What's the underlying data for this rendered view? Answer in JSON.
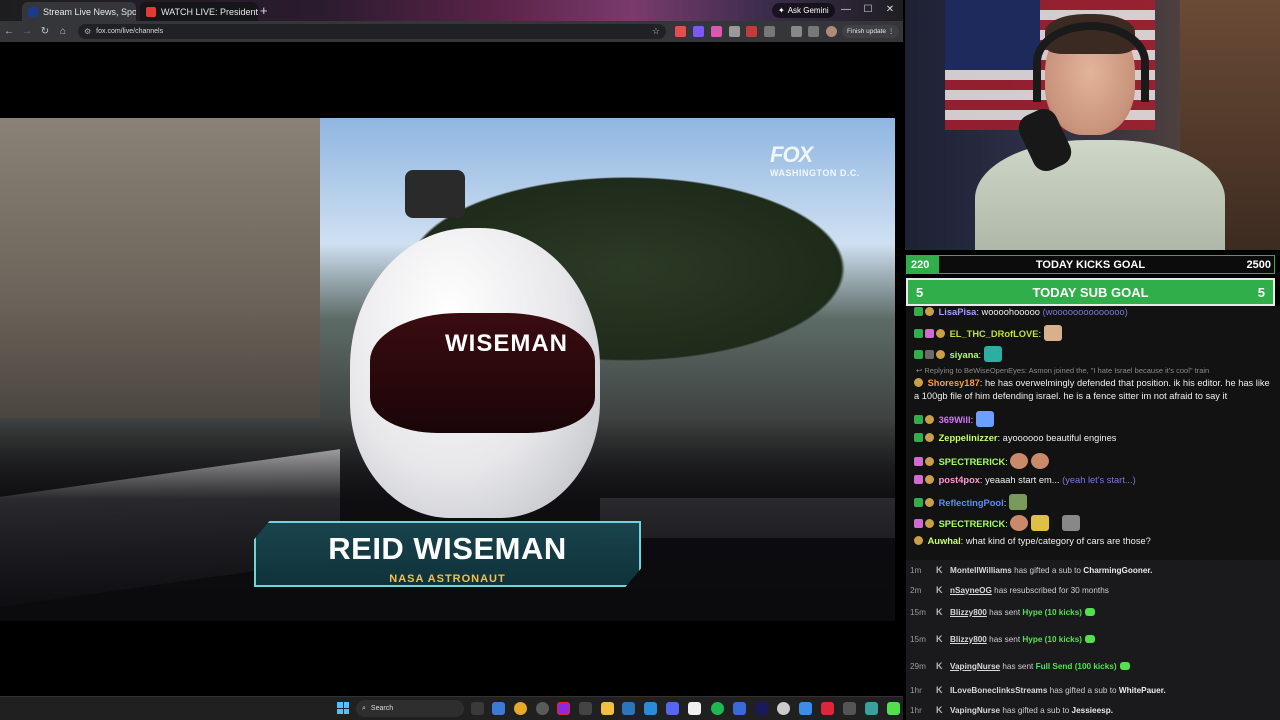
{
  "browser": {
    "tabs": [
      {
        "label": "Stream Live News, Sports, T",
        "active": true
      },
      {
        "label": "WATCH LIVE: President Trump",
        "active": false
      }
    ],
    "ask_gemini": "Ask Gemini",
    "url": "fox.com/live/channels",
    "finish_update": "Finish update"
  },
  "video": {
    "channel_logo": "FOX",
    "channel_city": "WASHINGTON D.C.",
    "helmet_text": "WISEMAN",
    "lower_third": {
      "name": "REID WISEMAN",
      "role": "NASA ASTRONAUT"
    }
  },
  "taskbar": {
    "search_placeholder": "Search"
  },
  "goals": {
    "kicks": {
      "current": "220",
      "label": "TODAY KICKS GOAL",
      "target": "2500",
      "progress": 0.088
    },
    "subs": {
      "current": "5",
      "label": "TODAY SUB GOAL",
      "target": "5",
      "progress": 1.0
    }
  },
  "chat": {
    "messages": [
      {
        "user": "LisaPisa",
        "color": "#a4a0ff",
        "text": "woooohooooo",
        "quote": "(woooooooooooooo)"
      },
      {
        "user": "EL_THC_DRofLOVE",
        "color": "#bfe33b",
        "text": ""
      },
      {
        "user": "siyana",
        "color": "#a4ff5a",
        "text": ""
      },
      {
        "reply": "Replying to BeWiseOpenEyes: Asmon joined the, \"I hate Israel because it's cool\" train"
      },
      {
        "user": "Shoresy187",
        "color": "#ff9b3a",
        "text": "he has overwelmingly defended that position. ik his editor. he has like a 100gb file of him defending israel. he is a fence sitter im not afraid to say it"
      },
      {
        "user": "369Will",
        "color": "#d873ff",
        "text": ""
      },
      {
        "user": "Zeppelinizzer",
        "color": "#c6ff6a",
        "text": "ayoooooo beautiful engines"
      },
      {
        "user": "SPECTRERICK",
        "color": "#a4ff5a",
        "text": ""
      },
      {
        "user": "post4pox",
        "color": "#ff9ad8",
        "text": "yeaaah start em...",
        "quote": "(yeah let's start...)"
      },
      {
        "user": "ReflectingPool",
        "color": "#5d8dff",
        "text": ""
      },
      {
        "user": "SPECTRERICK",
        "color": "#a4ff5a",
        "text": ""
      },
      {
        "user": "Auwhal",
        "color": "#c6ff6a",
        "text": "what kind of type/category of cars are those?"
      }
    ]
  },
  "feed": {
    "rows": [
      {
        "time": "1m",
        "user": "MontellWilliams",
        "text": "has gifted a sub to",
        "target": "CharmingGooner."
      },
      {
        "time": "2m",
        "user": "nSayneOG",
        "text": "has resubscribed for 30 months",
        "target": ""
      },
      {
        "time": "15m",
        "user": "Blizzy800",
        "text": "has sent",
        "highlight": "Hype (10 kicks)"
      },
      {
        "time": "15m",
        "user": "Blizzy800",
        "text": "has sent",
        "highlight": "Hype (10 kicks)"
      },
      {
        "time": "29m",
        "user": "VapingNurse",
        "text": "has sent",
        "highlight": "Full Send (100 kicks)"
      },
      {
        "time": "1hr",
        "user": "ILoveBoneclinksStreams",
        "text": "has gifted a sub to",
        "target": "WhitePauer."
      },
      {
        "time": "1hr",
        "user": "VapingNurse",
        "text": "has gifted a sub to",
        "target": "Jessieesp."
      }
    ]
  },
  "colors": {
    "goal_green": "#2fae4a",
    "kick_green": "#53e04f",
    "chat_bg": "#121212"
  }
}
